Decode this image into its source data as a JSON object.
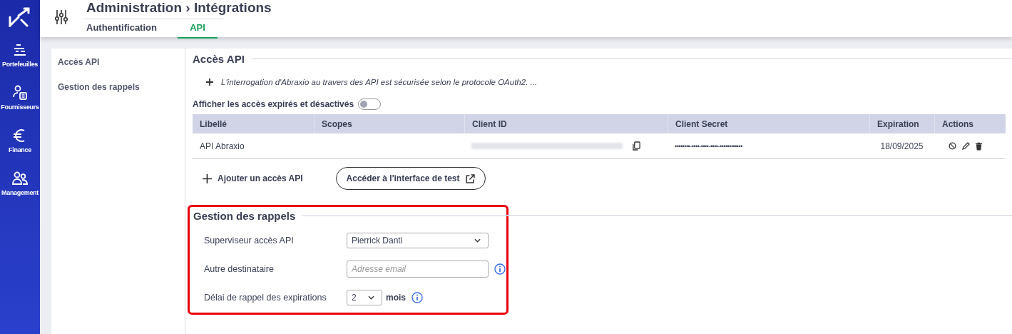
{
  "nav": [
    {
      "label": "Portefeuilles"
    },
    {
      "label": "Fournisseurs"
    },
    {
      "label": "Finance"
    },
    {
      "label": "Management"
    }
  ],
  "header": {
    "title": "Administration › Intégrations",
    "tabs": [
      {
        "label": "Authentification",
        "selected": false
      },
      {
        "label": "API",
        "selected": true
      }
    ]
  },
  "side_menu": [
    "Accès API",
    "Gestion des rappels"
  ],
  "api_section": {
    "title": "Accès API",
    "info": "L'interrogation d'Abraxio au travers des API est sécurisée selon le protocole OAuth2. ...",
    "toggle": {
      "label": "Afficher les accès expirés et désactivés",
      "on": false
    },
    "table": {
      "columns": [
        "Libellé",
        "Scopes",
        "Client ID",
        "Client Secret",
        "Expiration",
        "Actions"
      ],
      "rows": [
        {
          "label": "API Abraxio",
          "client_secret": "••••••••-••••-••••-••••-••••••••••••",
          "expiration": "18/09/2025"
        }
      ]
    },
    "add_label": "Ajouter un accès API",
    "test_button": "Accéder à l'interface de test"
  },
  "reminders": {
    "title": "Gestion des rappels",
    "highlighted": true,
    "supervisor": {
      "label": "Superviseur accès API",
      "value": "Pierrick Danti"
    },
    "recipient": {
      "label": "Autre destinataire",
      "placeholder": "Adresse email"
    },
    "delay": {
      "label": "Délai de rappel des expirations",
      "value": "2",
      "unit": "mois"
    }
  }
}
